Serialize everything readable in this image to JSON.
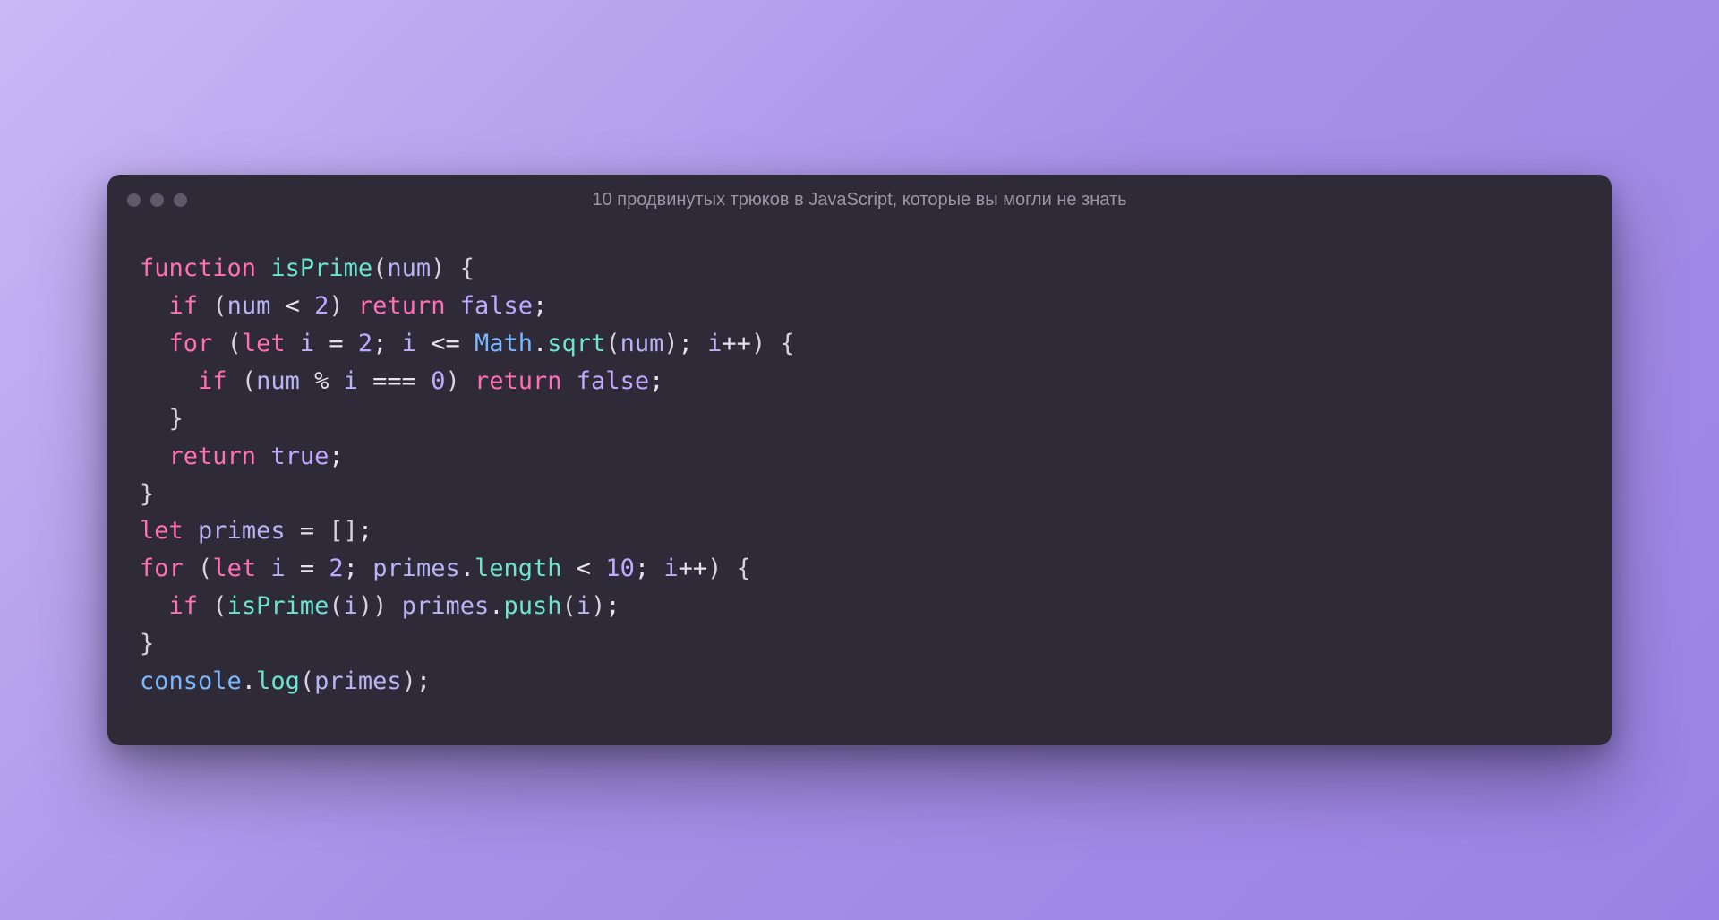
{
  "window": {
    "title": "10 продвинутых трюков в JavaScript, которые вы могли не знать"
  },
  "code": {
    "tokens": [
      [
        {
          "c": "tk-keyword",
          "t": "function"
        },
        {
          "c": "tk-op",
          "t": " "
        },
        {
          "c": "tk-func",
          "t": "isPrime"
        },
        {
          "c": "tk-brace",
          "t": "("
        },
        {
          "c": "tk-param",
          "t": "num"
        },
        {
          "c": "tk-brace",
          "t": ")"
        },
        {
          "c": "tk-op",
          "t": " "
        },
        {
          "c": "tk-brace",
          "t": "{"
        }
      ],
      [
        {
          "c": "tk-op",
          "t": "  "
        },
        {
          "c": "tk-keyword",
          "t": "if"
        },
        {
          "c": "tk-op",
          "t": " "
        },
        {
          "c": "tk-brace",
          "t": "("
        },
        {
          "c": "tk-param",
          "t": "num"
        },
        {
          "c": "tk-op",
          "t": " < "
        },
        {
          "c": "tk-num",
          "t": "2"
        },
        {
          "c": "tk-brace",
          "t": ")"
        },
        {
          "c": "tk-op",
          "t": " "
        },
        {
          "c": "tk-keyword",
          "t": "return"
        },
        {
          "c": "tk-op",
          "t": " "
        },
        {
          "c": "tk-bool",
          "t": "false"
        },
        {
          "c": "tk-op",
          "t": ";"
        }
      ],
      [
        {
          "c": "tk-op",
          "t": "  "
        },
        {
          "c": "tk-keyword",
          "t": "for"
        },
        {
          "c": "tk-op",
          "t": " "
        },
        {
          "c": "tk-brace",
          "t": "("
        },
        {
          "c": "tk-keyword",
          "t": "let"
        },
        {
          "c": "tk-op",
          "t": " "
        },
        {
          "c": "tk-param",
          "t": "i"
        },
        {
          "c": "tk-op",
          "t": " = "
        },
        {
          "c": "tk-num",
          "t": "2"
        },
        {
          "c": "tk-op",
          "t": "; "
        },
        {
          "c": "tk-param",
          "t": "i"
        },
        {
          "c": "tk-op",
          "t": " <= "
        },
        {
          "c": "tk-obj",
          "t": "Math"
        },
        {
          "c": "tk-op",
          "t": "."
        },
        {
          "c": "tk-func",
          "t": "sqrt"
        },
        {
          "c": "tk-brace",
          "t": "("
        },
        {
          "c": "tk-param",
          "t": "num"
        },
        {
          "c": "tk-brace",
          "t": ")"
        },
        {
          "c": "tk-op",
          "t": "; "
        },
        {
          "c": "tk-param",
          "t": "i"
        },
        {
          "c": "tk-op",
          "t": "++"
        },
        {
          "c": "tk-brace",
          "t": ")"
        },
        {
          "c": "tk-op",
          "t": " "
        },
        {
          "c": "tk-brace",
          "t": "{"
        }
      ],
      [
        {
          "c": "tk-op",
          "t": "    "
        },
        {
          "c": "tk-keyword",
          "t": "if"
        },
        {
          "c": "tk-op",
          "t": " "
        },
        {
          "c": "tk-brace",
          "t": "("
        },
        {
          "c": "tk-param",
          "t": "num"
        },
        {
          "c": "tk-op",
          "t": " % "
        },
        {
          "c": "tk-param",
          "t": "i"
        },
        {
          "c": "tk-op",
          "t": " === "
        },
        {
          "c": "tk-num",
          "t": "0"
        },
        {
          "c": "tk-brace",
          "t": ")"
        },
        {
          "c": "tk-op",
          "t": " "
        },
        {
          "c": "tk-keyword",
          "t": "return"
        },
        {
          "c": "tk-op",
          "t": " "
        },
        {
          "c": "tk-bool",
          "t": "false"
        },
        {
          "c": "tk-op",
          "t": ";"
        }
      ],
      [
        {
          "c": "tk-op",
          "t": "  "
        },
        {
          "c": "tk-brace",
          "t": "}"
        }
      ],
      [
        {
          "c": "tk-op",
          "t": "  "
        },
        {
          "c": "tk-keyword",
          "t": "return"
        },
        {
          "c": "tk-op",
          "t": " "
        },
        {
          "c": "tk-bool",
          "t": "true"
        },
        {
          "c": "tk-op",
          "t": ";"
        }
      ],
      [
        {
          "c": "tk-brace",
          "t": "}"
        }
      ],
      [
        {
          "c": "tk-keyword",
          "t": "let"
        },
        {
          "c": "tk-op",
          "t": " "
        },
        {
          "c": "tk-param",
          "t": "primes"
        },
        {
          "c": "tk-op",
          "t": " = "
        },
        {
          "c": "tk-brace",
          "t": "["
        },
        {
          "c": "tk-brace",
          "t": "]"
        },
        {
          "c": "tk-op",
          "t": ";"
        }
      ],
      [
        {
          "c": "tk-keyword",
          "t": "for"
        },
        {
          "c": "tk-op",
          "t": " "
        },
        {
          "c": "tk-brace",
          "t": "("
        },
        {
          "c": "tk-keyword",
          "t": "let"
        },
        {
          "c": "tk-op",
          "t": " "
        },
        {
          "c": "tk-param",
          "t": "i"
        },
        {
          "c": "tk-op",
          "t": " = "
        },
        {
          "c": "tk-num",
          "t": "2"
        },
        {
          "c": "tk-op",
          "t": "; "
        },
        {
          "c": "tk-param",
          "t": "primes"
        },
        {
          "c": "tk-op",
          "t": "."
        },
        {
          "c": "tk-prop",
          "t": "length"
        },
        {
          "c": "tk-op",
          "t": " < "
        },
        {
          "c": "tk-num",
          "t": "10"
        },
        {
          "c": "tk-op",
          "t": "; "
        },
        {
          "c": "tk-param",
          "t": "i"
        },
        {
          "c": "tk-op",
          "t": "++"
        },
        {
          "c": "tk-brace",
          "t": ")"
        },
        {
          "c": "tk-op",
          "t": " "
        },
        {
          "c": "tk-brace",
          "t": "{"
        }
      ],
      [
        {
          "c": "tk-op",
          "t": "  "
        },
        {
          "c": "tk-keyword",
          "t": "if"
        },
        {
          "c": "tk-op",
          "t": " "
        },
        {
          "c": "tk-brace",
          "t": "("
        },
        {
          "c": "tk-func",
          "t": "isPrime"
        },
        {
          "c": "tk-brace",
          "t": "("
        },
        {
          "c": "tk-param",
          "t": "i"
        },
        {
          "c": "tk-brace",
          "t": ")"
        },
        {
          "c": "tk-brace",
          "t": ")"
        },
        {
          "c": "tk-op",
          "t": " "
        },
        {
          "c": "tk-param",
          "t": "primes"
        },
        {
          "c": "tk-op",
          "t": "."
        },
        {
          "c": "tk-func",
          "t": "push"
        },
        {
          "c": "tk-brace",
          "t": "("
        },
        {
          "c": "tk-param",
          "t": "i"
        },
        {
          "c": "tk-brace",
          "t": ")"
        },
        {
          "c": "tk-op",
          "t": ";"
        }
      ],
      [
        {
          "c": "tk-brace",
          "t": "}"
        }
      ],
      [
        {
          "c": "tk-obj",
          "t": "console"
        },
        {
          "c": "tk-op",
          "t": "."
        },
        {
          "c": "tk-func",
          "t": "log"
        },
        {
          "c": "tk-brace",
          "t": "("
        },
        {
          "c": "tk-param",
          "t": "primes"
        },
        {
          "c": "tk-brace",
          "t": ")"
        },
        {
          "c": "tk-op",
          "t": ";"
        }
      ]
    ]
  }
}
